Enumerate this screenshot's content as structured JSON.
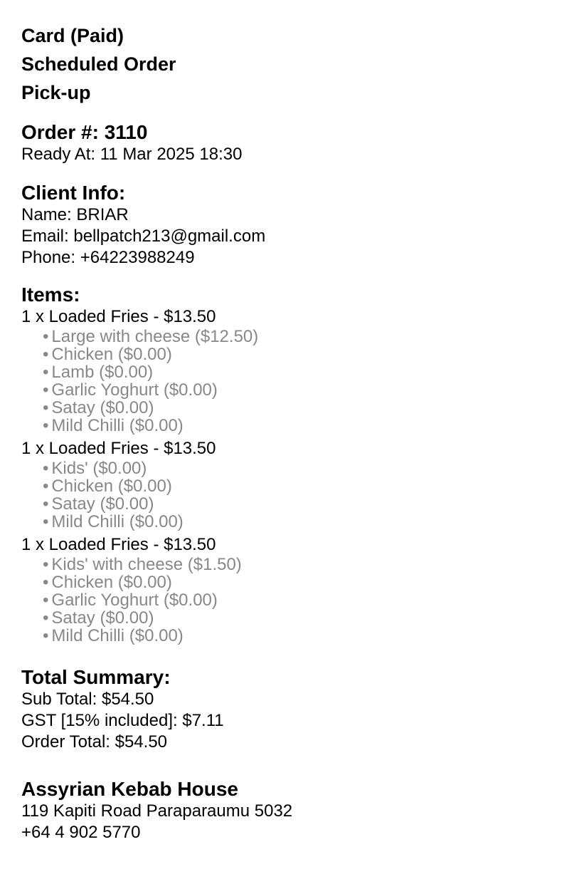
{
  "header": {
    "payment": "Card (Paid)",
    "schedule": "Scheduled Order",
    "fulfilment": "Pick-up"
  },
  "order": {
    "number_label": "Order #: 3110",
    "ready_at": "Ready At: 11 Mar 2025 18:30"
  },
  "client": {
    "title": "Client Info:",
    "name": "Name: BRIAR",
    "email": "Email: bellpatch213@gmail.com",
    "phone": "Phone: +64223988249"
  },
  "items": {
    "title": "Items:",
    "bullet": "•",
    "list": [
      {
        "line": "1 x Loaded Fries - $13.50",
        "options": [
          "Large with cheese ($12.50)",
          "Chicken ($0.00)",
          "Lamb ($0.00)",
          "Garlic Yoghurt ($0.00)",
          "Satay ($0.00)",
          "Mild Chilli ($0.00)"
        ]
      },
      {
        "line": "1 x Loaded Fries - $13.50",
        "options": [
          "Kids' ($0.00)",
          "Chicken ($0.00)",
          "Satay ($0.00)",
          "Mild Chilli ($0.00)"
        ]
      },
      {
        "line": "1 x Loaded Fries - $13.50",
        "options": [
          "Kids' with cheese ($1.50)",
          "Chicken ($0.00)",
          "Garlic Yoghurt ($0.00)",
          "Satay ($0.00)",
          "Mild Chilli ($0.00)"
        ]
      }
    ]
  },
  "summary": {
    "title": "Total Summary:",
    "subtotal": "Sub Total: $54.50",
    "gst": "GST [15% included]: $7.11",
    "total": "Order Total: $54.50"
  },
  "store": {
    "name": "Assyrian Kebab House",
    "address": "119 Kapiti Road Paraparaumu 5032",
    "phone": "+64 4 902 5770"
  },
  "colors": {
    "text": "#000000",
    "option_text": "#888888",
    "background": "#ffffff"
  }
}
